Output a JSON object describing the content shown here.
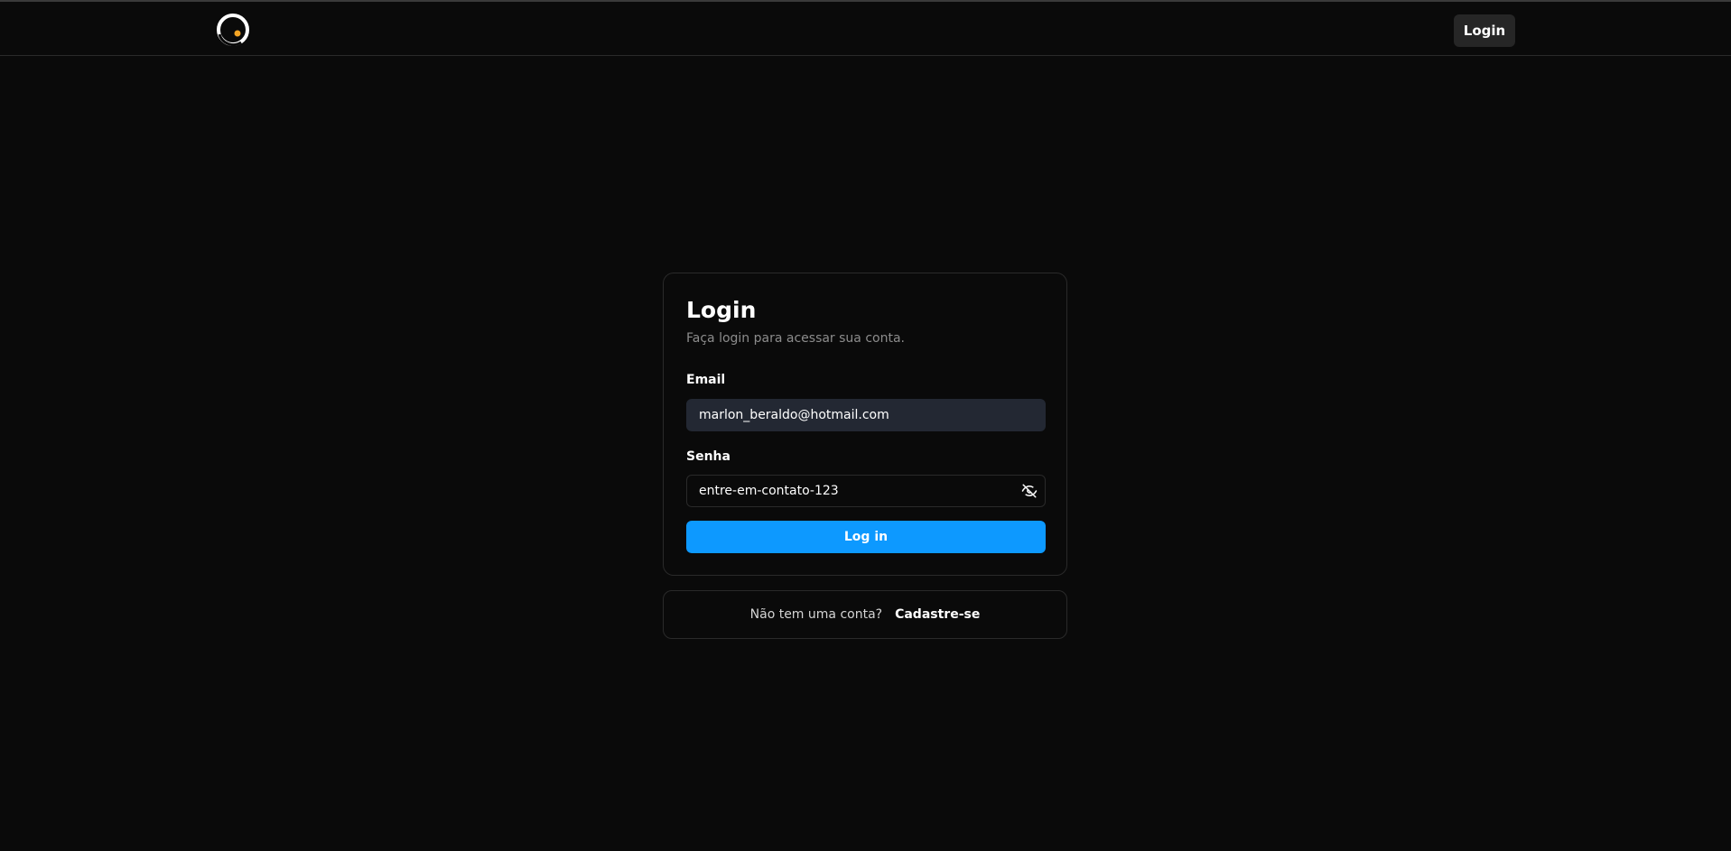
{
  "header": {
    "logo_icon": "logo-icon",
    "login_button_label": "Login"
  },
  "login_card": {
    "title": "Login",
    "subtitle": "Faça login para acessar sua conta.",
    "email_label": "Email",
    "email_value": "marlon_beraldo@hotmail.com",
    "password_label": "Senha",
    "password_value": "entre-em-contato-123",
    "password_toggle_icon": "eye-off-icon",
    "submit_label": "Log in"
  },
  "signup": {
    "prompt": "Não tem uma conta?",
    "link_label": "Cadastre-se"
  },
  "colors": {
    "background": "#0a0a0a",
    "accent": "#0d99ff",
    "input_fill": "#232833",
    "border": "#2a2a2a"
  }
}
